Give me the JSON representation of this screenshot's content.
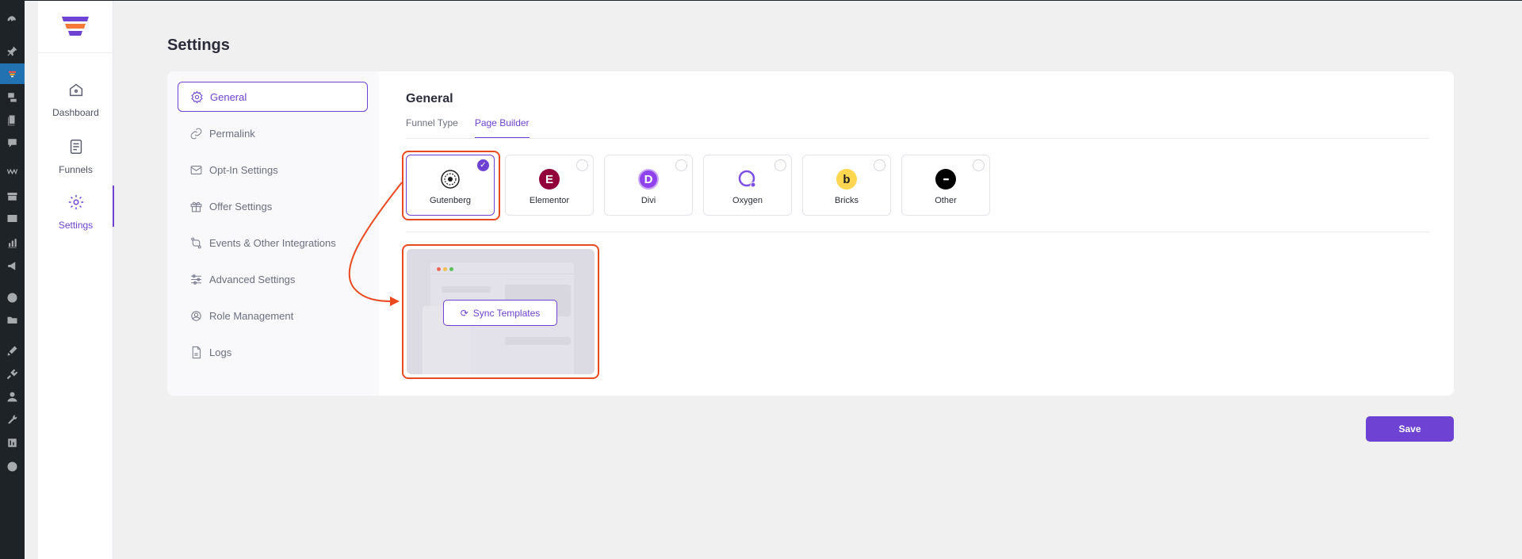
{
  "plugin_nav": [
    {
      "label": "Dashboard"
    },
    {
      "label": "Funnels"
    },
    {
      "label": "Settings"
    }
  ],
  "page": {
    "title": "Settings"
  },
  "settings_menu": [
    {
      "label": "General",
      "icon": "gear-icon"
    },
    {
      "label": "Permalink",
      "icon": "link-icon"
    },
    {
      "label": "Opt-In Settings",
      "icon": "envelope-icon"
    },
    {
      "label": "Offer Settings",
      "icon": "gift-icon"
    },
    {
      "label": "Events & Other Integrations",
      "icon": "integrations-icon"
    },
    {
      "label": "Advanced Settings",
      "icon": "sliders-icon"
    },
    {
      "label": "Role Management",
      "icon": "user-gear-icon"
    },
    {
      "label": "Logs",
      "icon": "file-icon"
    }
  ],
  "general": {
    "title": "General",
    "tabs": [
      {
        "label": "Funnel Type"
      },
      {
        "label": "Page Builder"
      }
    ],
    "active_tab": "Page Builder"
  },
  "page_builders": [
    {
      "label": "Gutenberg",
      "selected": true,
      "color": "#1e1e1e"
    },
    {
      "label": "Elementor",
      "selected": false,
      "color": "#92003b",
      "glyph": "E"
    },
    {
      "label": "Divi",
      "selected": false,
      "color": "#8f42ec",
      "glyph": "D"
    },
    {
      "label": "Oxygen",
      "selected": false,
      "color": "#7d4ee4"
    },
    {
      "label": "Bricks",
      "selected": false,
      "color": "#ffd64f",
      "glyph": "b"
    },
    {
      "label": "Other",
      "selected": false,
      "color": "#000000",
      "glyph": "•••"
    }
  ],
  "template_preview": {
    "sync_label": "Sync Templates"
  },
  "actions": {
    "save_label": "Save"
  },
  "colors": {
    "accent": "#6e42d3",
    "annotation": "#ea4a21"
  }
}
